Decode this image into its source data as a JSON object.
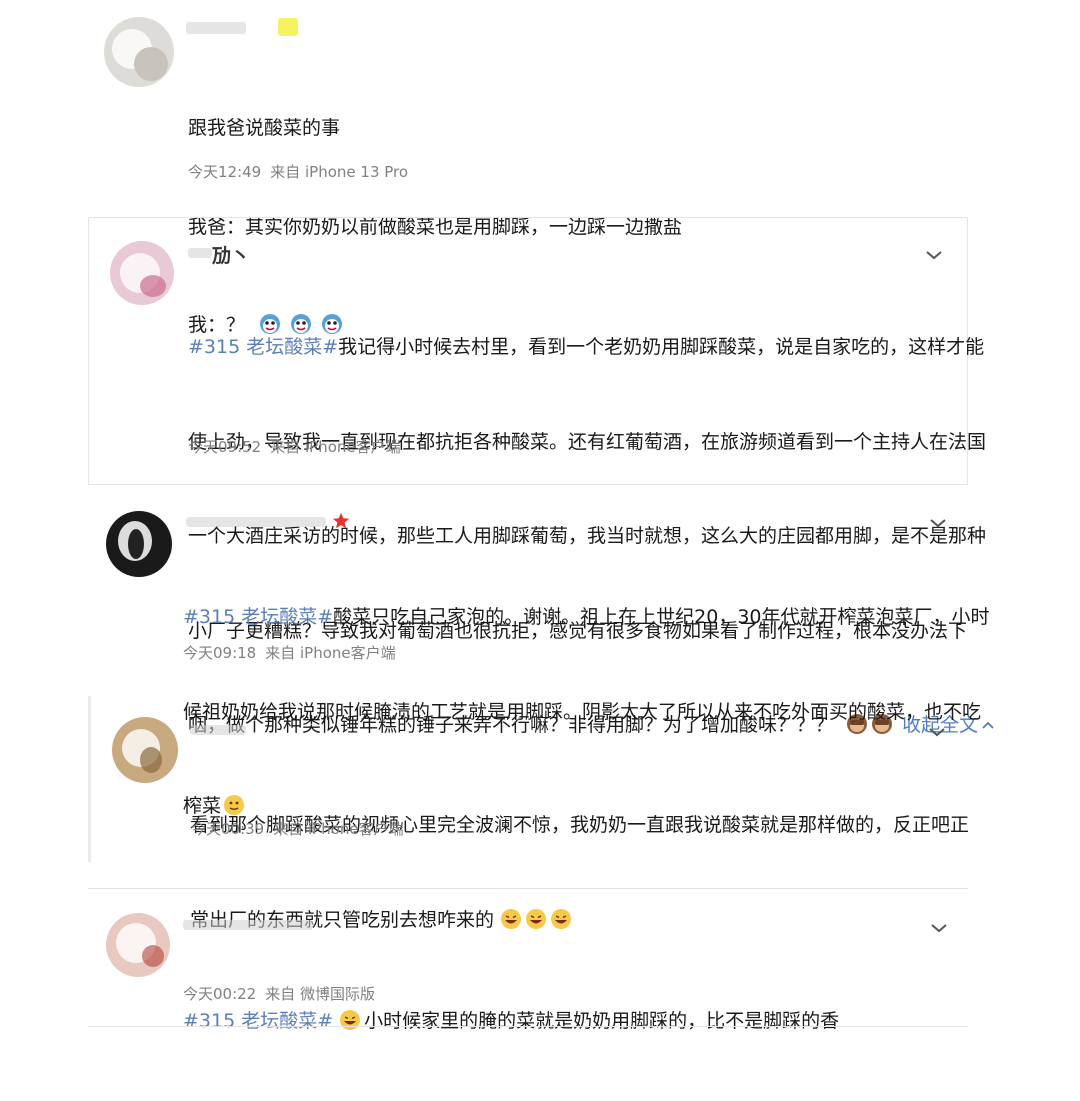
{
  "posts": [
    {
      "id": "p1",
      "author": "",
      "lines": [
        "跟我爸说酸菜的事",
        "我爸：其实你奶奶以前做酸菜也是用脚踩，一边踩一边撒盐",
        "我：？"
      ],
      "emojis": [
        "doge-emoji",
        "doge-emoji",
        "doge-emoji"
      ],
      "time": "今天12:49",
      "source": "来自 iPhone 13 Pro"
    },
    {
      "id": "p2",
      "author": "劢丶",
      "hashtag": "#315 老坛酸菜#",
      "lines": [
        "我记得小时候去村里，看到一个老奶奶用脚踩酸菜，说是自家吃的，这样才能",
        "使上劲，导致我一直到现在都抗拒各种酸菜。还有红葡萄酒，在旅游频道看到一个主持人在法国",
        "一个大酒庄采访的时候，那些工人用脚踩葡萄，我当时就想，这么大的庄园都用脚，是不是那种",
        "小厂子更糟糕？导致我对葡萄酒也很抗拒，感觉有很多食物如果看了制作过程，根本没办法下",
        "咽，做个那种类似锤年糕的锤子来弄不行嘛？非得用脚？为了增加酸味？？？"
      ],
      "emojis": [
        "see-no-evil-monkey-emoji",
        "see-no-evil-monkey-emoji"
      ],
      "collapse_label": "收起全文",
      "time": "今天09:52",
      "source": "来自 iPhone客户端"
    },
    {
      "id": "p3",
      "author": "",
      "hashtag": "#315 老坛酸菜#",
      "lines": [
        "酸菜只吃自己家泡的。谢谢。祖上在上世纪20，30年代就开榨菜泡菜厂，小时",
        "候祖奶奶给我说那时候腌渍的工艺就是用脚踩。阴影太大了所以从来不吃外面买的酸菜，也不吃",
        "榨菜"
      ],
      "emojis": [
        "slight-smile-emoji"
      ],
      "time": "今天09:18",
      "source": "来自 iPhone客户端"
    },
    {
      "id": "p4",
      "author": "",
      "lines": [
        "看到那个脚踩酸菜的视频心里完全波澜不惊，我奶奶一直跟我说酸菜就是那样做的，反正吧正",
        "常出厂的东西就只管吃别去想咋来的"
      ],
      "emojis": [
        "laughing-emoji",
        "laughing-emoji",
        "laughing-emoji"
      ],
      "time": "今天00:39",
      "source": "来自 iPhone客户端"
    },
    {
      "id": "p5",
      "author": "",
      "hashtag": "#315 老坛酸菜#",
      "lines": [
        "小时候家里的腌的菜就是奶奶用脚踩的，比不是脚踩的香"
      ],
      "emojis": [
        "laughing-emoji"
      ],
      "time": "今天00:22",
      "source": "来自 微博国际版"
    }
  ],
  "colors": {
    "hashtag": "#5b7fb8",
    "meta": "#808080",
    "star": "#e8322e"
  }
}
